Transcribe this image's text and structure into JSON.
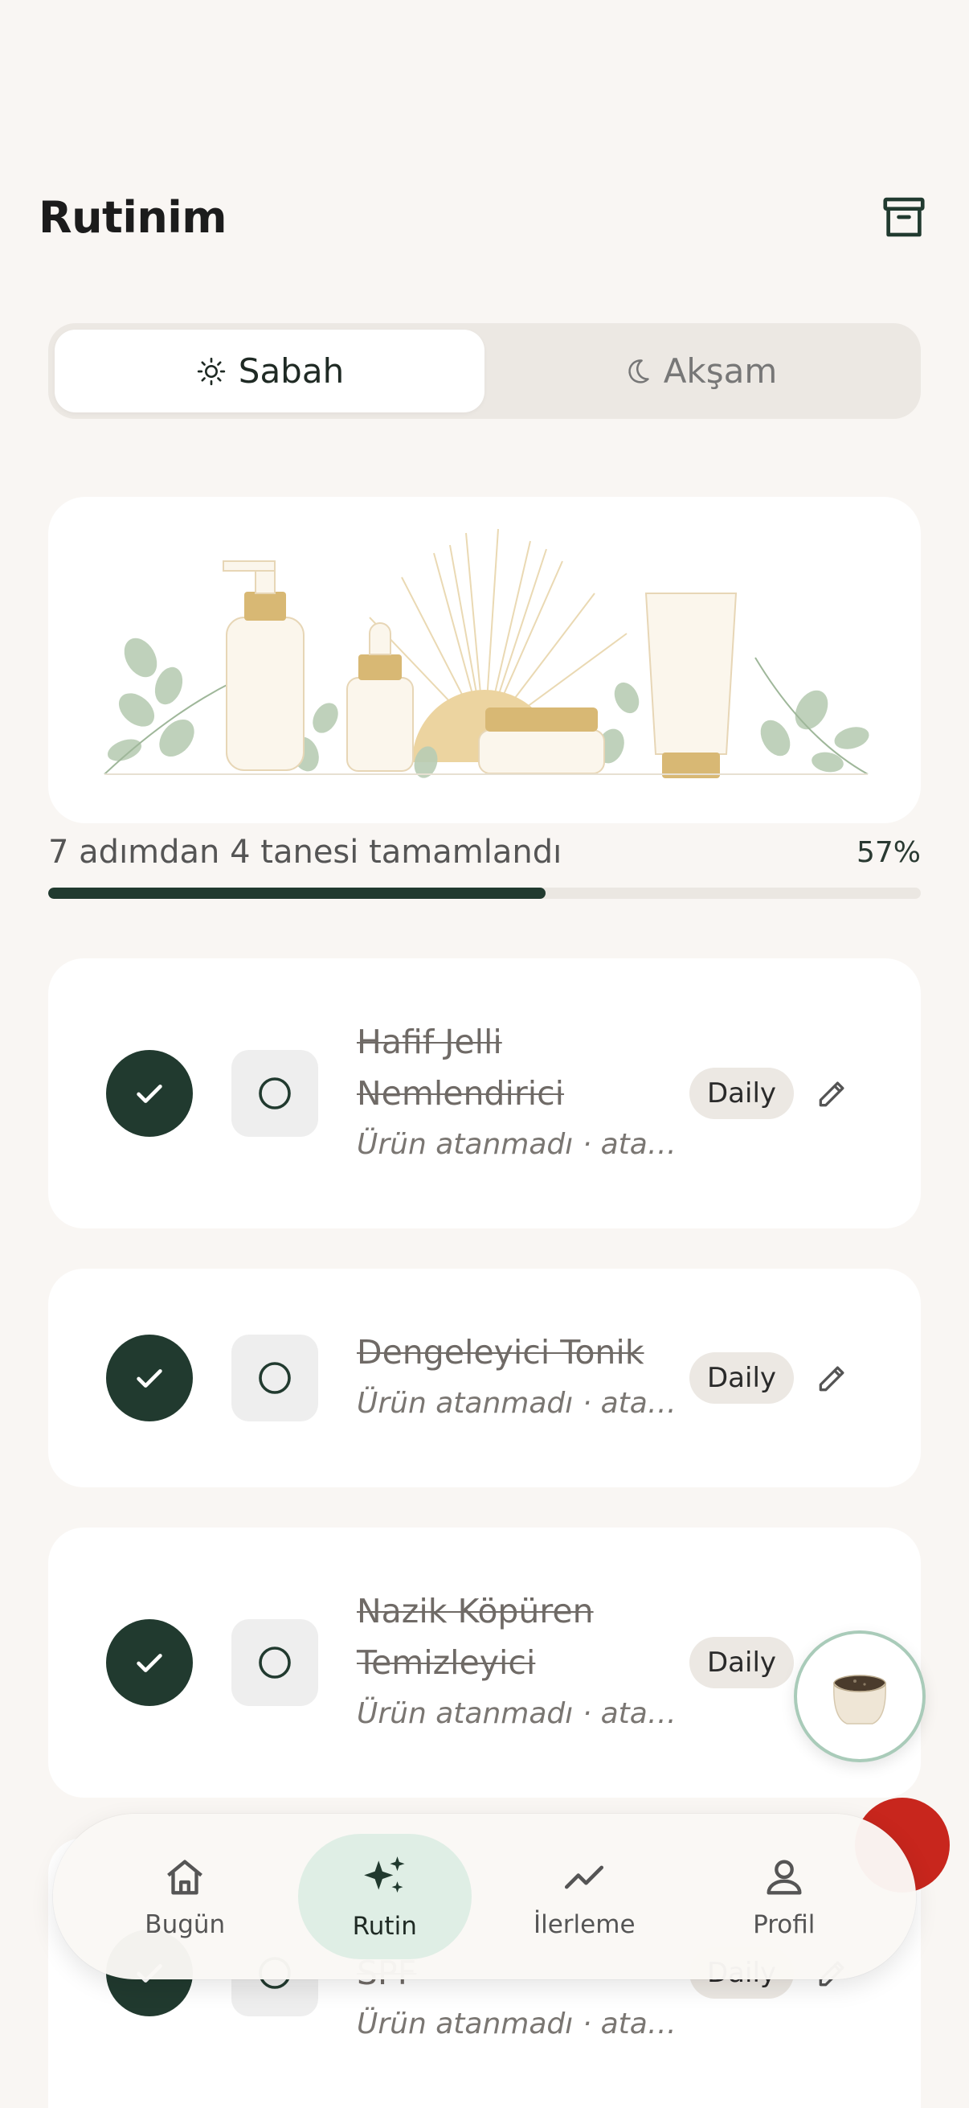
{
  "header": {
    "title": "Rutinim"
  },
  "tabs": [
    {
      "label": "Sabah",
      "icon": "sun-icon",
      "active": true
    },
    {
      "label": "Akşam",
      "icon": "moon-icon",
      "active": false
    }
  ],
  "progress": {
    "text": "7 adımdan 4 tanesi tamamlandı",
    "percent_label": "57%",
    "fraction": 0.57
  },
  "steps": [
    {
      "name": "Hafif Jelli Nemlendirici",
      "meta": "Ürün atanmadı · atanmamış ürün",
      "badge": "Daily",
      "done": true
    },
    {
      "name": "Dengeleyici Tonik",
      "meta": "Ürün atanmadı · atanmamış ürün",
      "badge": "Daily",
      "done": true
    },
    {
      "name": "Nazik Köpüren Temizleyici",
      "meta": "Ürün atanmadı · atanmamış ürün",
      "badge": "Daily",
      "done": true
    },
    {
      "name": "SPF",
      "meta": "Ürün atanmadı · atanmamış ürün",
      "badge": "Daily",
      "done": true
    }
  ],
  "nav": [
    {
      "label": "Bugün",
      "icon": "home-icon",
      "active": false
    },
    {
      "label": "Rutin",
      "icon": "sparkles-icon",
      "active": true
    },
    {
      "label": "İlerleme",
      "icon": "trend-icon",
      "active": false
    },
    {
      "label": "Profil",
      "icon": "person-icon",
      "active": false
    }
  ],
  "colors": {
    "accent": "#213a2f",
    "background": "#f9f6f3",
    "nav_active": "#dfeee5",
    "fab_red": "#c8261d"
  }
}
